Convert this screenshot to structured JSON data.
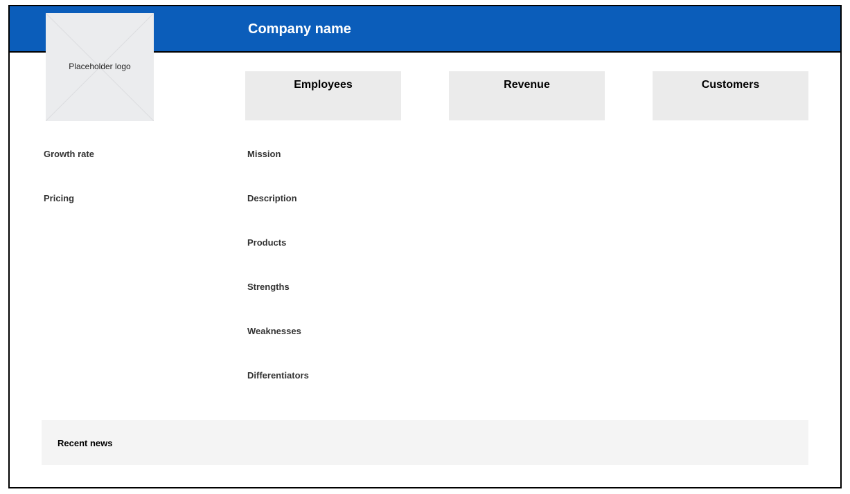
{
  "header": {
    "company_name": "Company name",
    "background_color": "#0b5dba"
  },
  "logo": {
    "text": "Placeholder logo"
  },
  "stats": [
    {
      "label": "Employees"
    },
    {
      "label": "Revenue"
    },
    {
      "label": "Customers"
    }
  ],
  "left_fields": [
    {
      "label": "Growth rate"
    },
    {
      "label": "Pricing"
    }
  ],
  "main_fields": [
    {
      "label": "Mission"
    },
    {
      "label": "Description"
    },
    {
      "label": "Products"
    },
    {
      "label": "Strengths"
    },
    {
      "label": "Weaknesses"
    },
    {
      "label": "Differentiators"
    }
  ],
  "news": {
    "label": "Recent news"
  }
}
